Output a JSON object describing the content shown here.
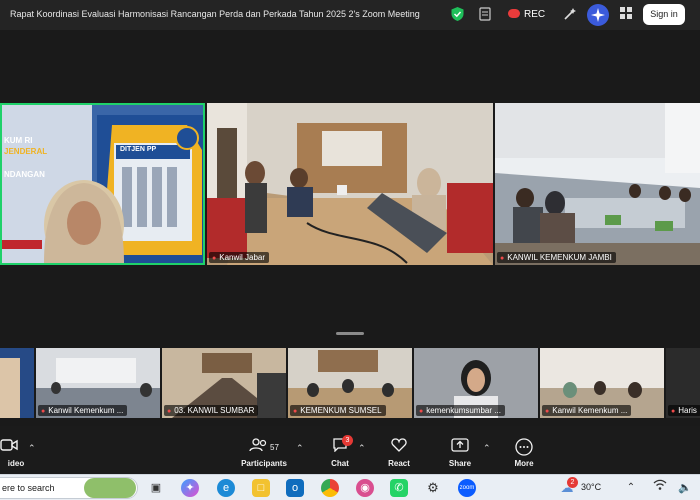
{
  "window": {
    "title": "Rapat Koordinasi Evaluasi Harmonisasi Rancangan Perda dan Perkada Tahun 2025 2's Zoom Meeting",
    "rec_label": "REC",
    "signin_label": "Sign in"
  },
  "main_tiles": [
    {
      "name": "",
      "banner_text": [
        "KUM RI",
        "JENDERAL",
        "NDANGAN"
      ],
      "sign_text": "DITJEN PP"
    },
    {
      "name": "Kanwil Jabar"
    },
    {
      "name": "KANWIL KEMENKUM JAMBI"
    }
  ],
  "strip_tiles": [
    {
      "name": "Kanwil Kemenkum ..."
    },
    {
      "name": "03. KANWIL SUMBAR"
    },
    {
      "name": "KEMENKUM SUMSEL"
    },
    {
      "name": "kemenkumsumbar ..."
    },
    {
      "name": "Kanwil Kemenkum ..."
    },
    {
      "name": "Haris"
    }
  ],
  "toolbar": {
    "video_label": "ideo",
    "participants_label": "Participants",
    "participants_count": "57",
    "chat_label": "Chat",
    "chat_badge": "3",
    "react_label": "React",
    "share_label": "Share",
    "more_label": "More"
  },
  "taskbar": {
    "search_text": "ere to search",
    "weather_badge": "2",
    "temperature": "30°C"
  },
  "colors": {
    "active_speaker_border": "#1fd16a",
    "rec_dot": "#ea3b3b",
    "zoom_blue": "#0b5cff"
  }
}
